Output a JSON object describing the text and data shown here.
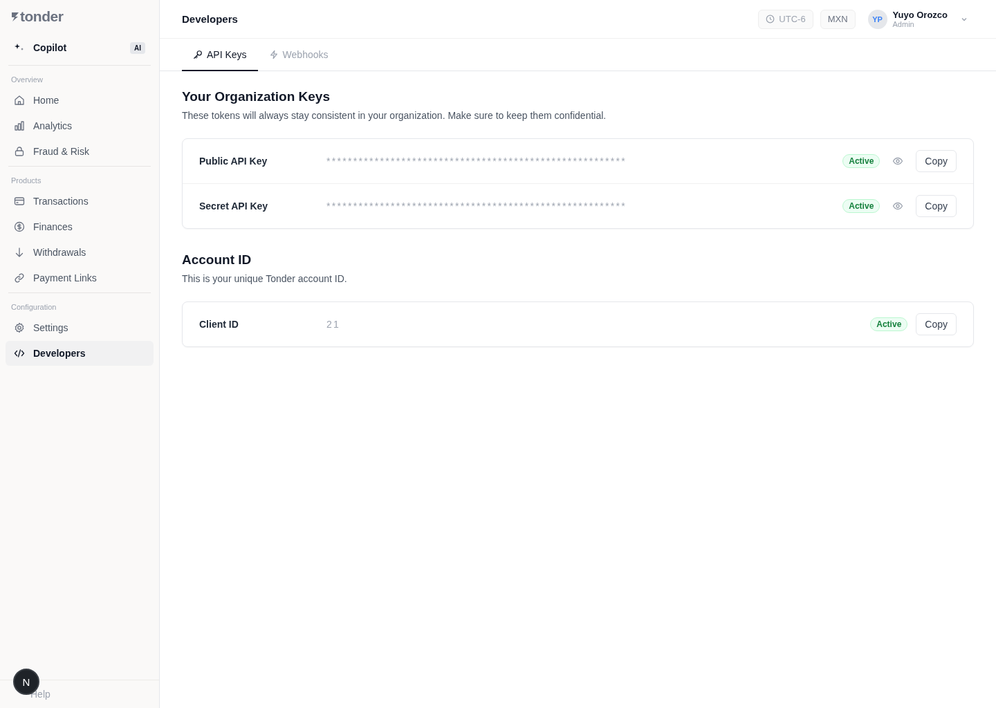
{
  "sidebar": {
    "logo": "tonder",
    "copilot": {
      "label": "Copilot",
      "badge": "AI"
    },
    "sections": [
      {
        "title": "Overview",
        "items": [
          {
            "label": "Home",
            "kind": "home",
            "selected": false
          },
          {
            "label": "Analytics",
            "kind": "chart",
            "selected": false
          },
          {
            "label": "Fraud & Risk",
            "kind": "lock",
            "selected": false
          }
        ]
      },
      {
        "title": "Products",
        "items": [
          {
            "label": "Transactions",
            "kind": "card",
            "selected": false
          },
          {
            "label": "Finances",
            "kind": "dollar",
            "selected": false
          },
          {
            "label": "Withdrawals",
            "kind": "down",
            "selected": false
          },
          {
            "label": "Payment Links",
            "kind": "link",
            "selected": false
          }
        ]
      },
      {
        "title": "Configuration",
        "items": [
          {
            "label": "Settings",
            "kind": "gear",
            "selected": false
          },
          {
            "label": "Developers",
            "kind": "code",
            "selected": true
          }
        ]
      }
    ],
    "help": "Help",
    "dev_badge": "N"
  },
  "header": {
    "title": "Developers",
    "timezone": "UTC-6",
    "currency": "MXN",
    "user": {
      "initials": "YP",
      "name": "Yuyo Orozco",
      "role": "Admin"
    }
  },
  "tabs": [
    {
      "label": "API Keys",
      "kind": "key",
      "selected": true
    },
    {
      "label": "Webhooks",
      "kind": "bolt",
      "selected": false
    }
  ],
  "sections": [
    {
      "title": "Your Organization Keys",
      "description": "These tokens will always stay consistent in your organization. Make sure to keep them confidential.",
      "rows": [
        {
          "label": "Public API Key",
          "value": "********************************************************",
          "status": "Active",
          "revealable": true,
          "button": "Copy"
        },
        {
          "label": "Secret API Key",
          "value": "********************************************************",
          "status": "Active",
          "revealable": true,
          "button": "Copy"
        }
      ]
    },
    {
      "title": "Account ID",
      "description": "This is your unique Tonder account ID.",
      "rows": [
        {
          "label": "Client ID",
          "value": "21",
          "status": "Active",
          "revealable": false,
          "button": "Copy"
        }
      ]
    }
  ]
}
